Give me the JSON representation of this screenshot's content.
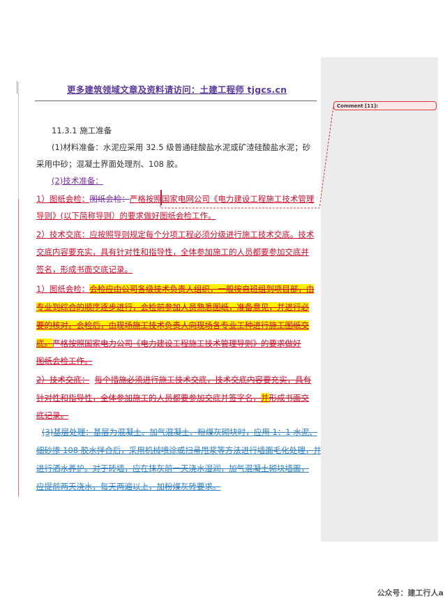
{
  "header": {
    "link_text": "更多建筑领域文章及资料请访问：土建工程师 tjgcs.cn"
  },
  "body": {
    "section_title": "11.3.1 施工准备",
    "p1_a": "(1)材料准备：水泥应采用 32.5 级普通硅酸盐水泥或矿渣硅酸盐水泥；砂",
    "p1_b": "采用中砂；混凝土界面处理剂、108 胶。",
    "p2_heading": "(2)技术准备：",
    "r1_a1": "1）图纸会检：",
    "r1_a2": "图纸会检：",
    "r1_a3": "严格按照国家电网公司《电力建设工程施工技术管理",
    "r1_b": "导则》(以下简称导则）的要求做好图纸会检工作。",
    "r2_a": "2）技术交底：应按照导则规定每个分项工程必须分级进行施工技术交底。技术",
    "r2_b": "交底内容要充实，具有针对性和指导性，全体参加施工的人员都要参加交底并",
    "r2_c": "签名，形成书面交底记录。",
    "d1_a1": "1）图纸会检：",
    "d1_a2": "会检应由公司各级技术负责人组织，一般按自班组到项目部，由",
    "d1_b": "专业到综合的顺序逐步进行，会检前参加人员熟悉图纸，准备意见，并进行必",
    "d1_c": "要的核对。会检后，由现场施工技术负责人向现场各专业工种进行施工图纸交",
    "d1_d1": "底。",
    "d1_d2": "严格按照国家电力公司《电力建设工程施工技术管理导则》的要求做好",
    "d1_e": "图纸会检工作。",
    "d2_a1": "2）技术交底：",
    "d2_a2": "每个措施必须进行施工技术交底，技术交底内容要充实，具有",
    "d2_b1": "针对性和指导性，全体参加施工的人员都要参加交底并签字名，",
    "d2_b2": "并",
    "d2_b3": "形成书面交",
    "d2_c": "底记录。",
    "b_a": "(3)基层处理：基层为混凝土、加气混凝土、粉煤灰砌块时，应用 1：1 水泥、",
    "b_b": "细砂掺 108 胶水拌合后，采用机械喷涂或扫帚甩浆等方法进行墙面毛化处理，并",
    "b_c": "进行洒水养护。对于砖墙，应在抹灰前一天浇水湿润，加气混凝土砌块墙面，",
    "b_d": "应提前两天浇水，每天两遍以上，加粉煤灰砖要求。"
  },
  "comment": {
    "label": "Comment [11]:"
  },
  "footer": {
    "text": "公众号：建工行人a"
  },
  "colors": {
    "insert_red": "#c8102e",
    "purple": "#7a2ea0",
    "blue": "#2f7fc1",
    "highlight": "#fff200",
    "comment_pane": "#ececec"
  }
}
